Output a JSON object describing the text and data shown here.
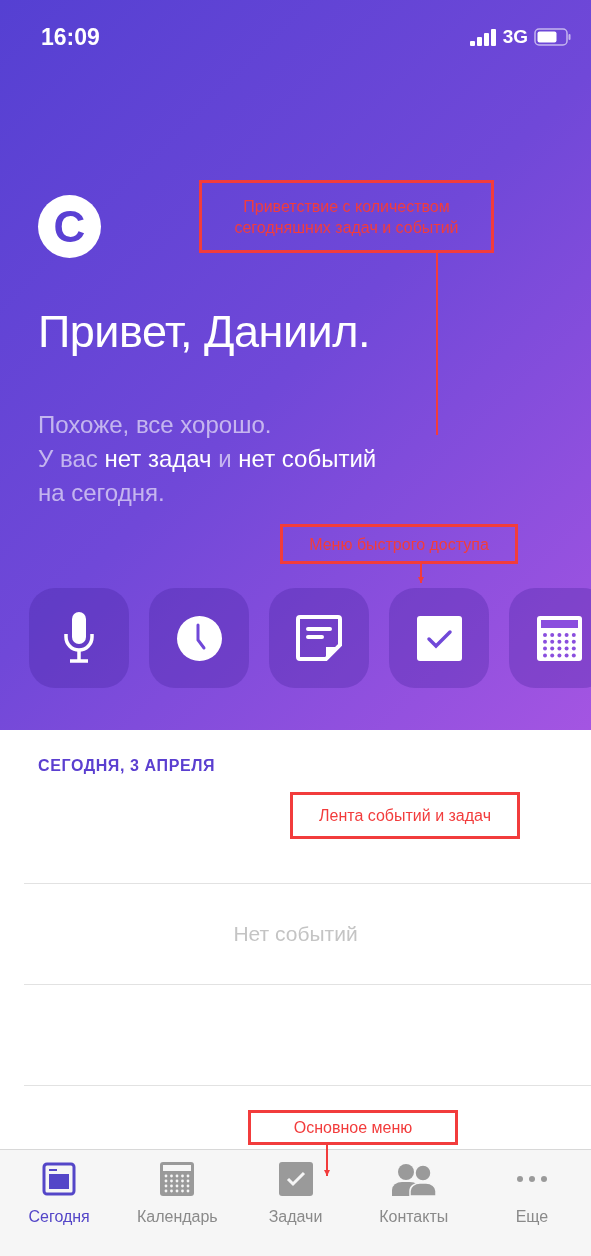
{
  "status_bar": {
    "time": "16:09",
    "network": "3G"
  },
  "hero": {
    "logo": "C",
    "title": "Привет, Даниил.",
    "subtitle": [
      "Похоже, все хорошо.",
      "У вас **нет задач** и **нет событий**",
      "на сегодня."
    ],
    "quick_actions": [
      {
        "kind": "mic"
      },
      {
        "kind": "clock"
      },
      {
        "kind": "note"
      },
      {
        "kind": "task"
      },
      {
        "kind": "calendar"
      }
    ]
  },
  "feed": {
    "date": "СЕГОДНЯ, 3 АПРЕЛЯ",
    "empty_text": "Нет событий"
  },
  "tab_bar": [
    {
      "kind": "today",
      "label": "Сегодня",
      "selected": true
    },
    {
      "kind": "calendar",
      "label": "Календарь",
      "selected": false
    },
    {
      "kind": "tasks",
      "label": "Задачи",
      "selected": false
    },
    {
      "kind": "contacts",
      "label": "Контакты",
      "selected": false
    },
    {
      "kind": "more",
      "label": "Еще",
      "selected": false
    }
  ],
  "annotations": [
    {
      "text": "Приветствие с количеством сегодняшних задач и событий",
      "kind": "line"
    },
    {
      "text": "Меню быстрого доступа",
      "kind": "arrow"
    },
    {
      "text": "Лента событий и задач",
      "kind": "plain"
    },
    {
      "text": "Основное меню",
      "kind": "arrow"
    }
  ]
}
